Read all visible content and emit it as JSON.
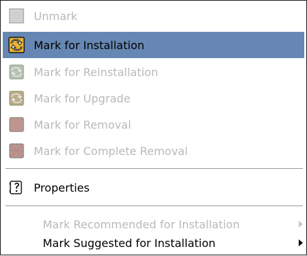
{
  "menu": {
    "items": [
      {
        "label": "Unmark",
        "icon": "unmark-icon",
        "enabled": false
      },
      {
        "label": "Mark for Installation",
        "icon": "install-icon",
        "enabled": true,
        "selected": true
      },
      {
        "label": "Mark for Reinstallation",
        "icon": "reinstall-icon",
        "enabled": false
      },
      {
        "label": "Mark for Upgrade",
        "icon": "upgrade-icon",
        "enabled": false
      },
      {
        "label": "Mark for Removal",
        "icon": "remove-icon",
        "enabled": false
      },
      {
        "label": "Mark for Complete Removal",
        "icon": "complete-remove-icon",
        "enabled": false
      },
      {
        "label": "Properties",
        "icon": "properties-icon",
        "enabled": true
      },
      {
        "label": "Mark Recommended for Installation",
        "enabled": false,
        "submenu": true
      },
      {
        "label": "Mark Suggested for Installation",
        "enabled": true,
        "submenu": true
      }
    ]
  },
  "colors": {
    "selection": "#6687b3",
    "disabled_text": "#b9b9b9",
    "border": "#1a1a1a"
  }
}
